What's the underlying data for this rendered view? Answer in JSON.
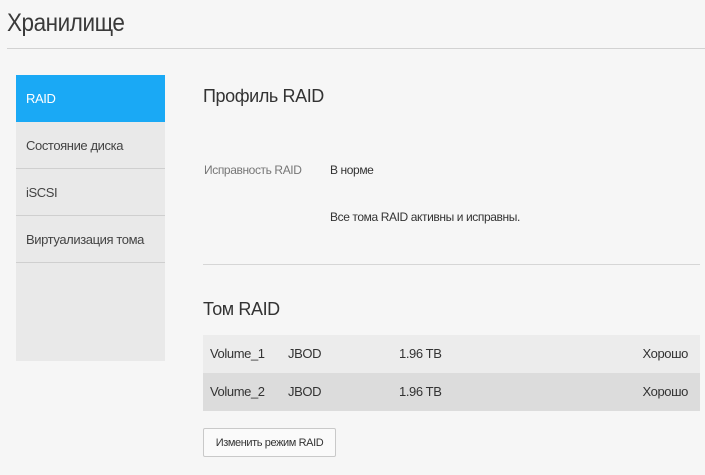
{
  "page": {
    "title": "Хранилище"
  },
  "sidebar": {
    "items": [
      {
        "label": "RAID",
        "active": true
      },
      {
        "label": "Состояние диска",
        "active": false
      },
      {
        "label": "iSCSI",
        "active": false
      },
      {
        "label": "Виртуализация тома",
        "active": false
      }
    ]
  },
  "raid_profile": {
    "heading": "Профиль RAID",
    "health_label": "Исправность RAID",
    "health_value": "В норме",
    "health_description": "Все тома RAID активны и исправны."
  },
  "raid_volumes": {
    "heading": "Том RAID",
    "rows": [
      {
        "name": "Volume_1",
        "type": "JBOD",
        "size": "1.96 TB",
        "status": "Хорошо"
      },
      {
        "name": "Volume_2",
        "type": "JBOD",
        "size": "1.96 TB",
        "status": "Хорошо"
      }
    ]
  },
  "actions": {
    "change_raid_mode": "Изменить режим RAID"
  },
  "colors": {
    "accent": "#1aa9f5",
    "sidebar_bg": "#e9e9e9",
    "page_bg": "#f6f6f6"
  }
}
